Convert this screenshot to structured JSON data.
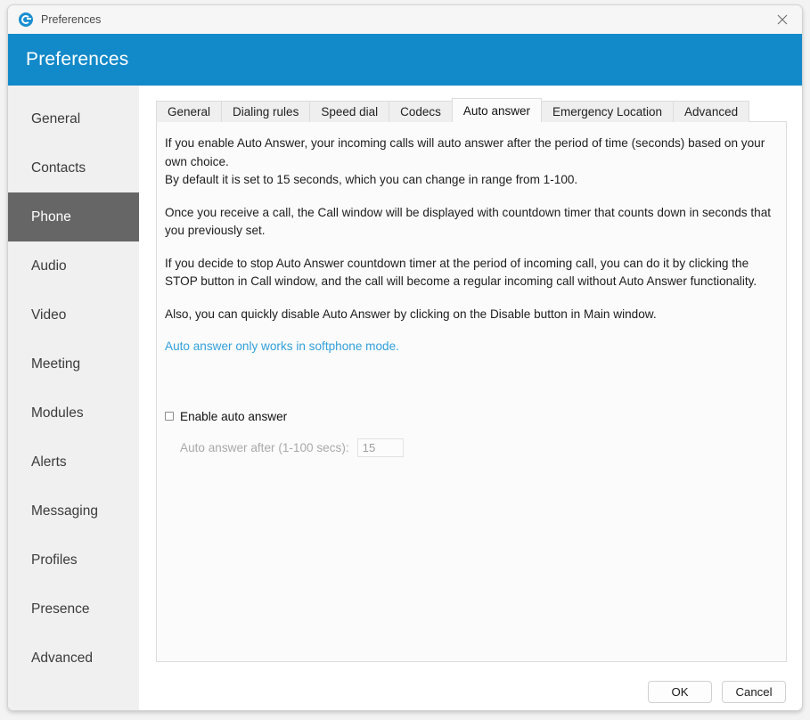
{
  "titlebar": {
    "app_icon": "app-logo-icon",
    "title": "Preferences",
    "close_icon": "close-icon"
  },
  "header": {
    "title": "Preferences",
    "accent_color": "#1289c9"
  },
  "sidebar": {
    "selected": "Phone",
    "selected_bg": "#666666",
    "items": [
      {
        "label": "General"
      },
      {
        "label": "Contacts"
      },
      {
        "label": "Phone"
      },
      {
        "label": "Audio"
      },
      {
        "label": "Video"
      },
      {
        "label": "Meeting"
      },
      {
        "label": "Modules"
      },
      {
        "label": "Alerts"
      },
      {
        "label": "Messaging"
      },
      {
        "label": "Profiles"
      },
      {
        "label": "Presence"
      },
      {
        "label": "Advanced"
      }
    ]
  },
  "main": {
    "active_tab": "Auto answer",
    "tabs": [
      {
        "label": "General"
      },
      {
        "label": "Dialing rules"
      },
      {
        "label": "Speed dial"
      },
      {
        "label": "Codecs"
      },
      {
        "label": "Auto answer"
      },
      {
        "label": "Emergency Location"
      },
      {
        "label": "Advanced"
      }
    ],
    "paragraphs": [
      "If you enable Auto Answer, your incoming calls will auto answer after the period of time (seconds) based on your own choice.\nBy default it is set to 15 seconds, which you can change in range from 1-100.",
      "Once you receive a call, the Call window will be displayed with countdown timer that counts down in seconds that you previously set.",
      "If you decide to stop Auto Answer countdown timer at the period of incoming call, you can do it by clicking the STOP button in Call window, and the call will become a regular incoming call without Auto Answer functionality.",
      "Also, you can quickly disable Auto Answer by clicking on the Disable button in Main window."
    ],
    "link_note": "Auto answer only works in softphone mode.",
    "link_color": "#31a0db",
    "enable_checkbox": {
      "label": "Enable auto answer",
      "checked": false
    },
    "auto_answer_after": {
      "label": "Auto answer after (1-100 secs):",
      "value": "15",
      "placeholder": "15",
      "disabled": true
    }
  },
  "footer": {
    "ok_label": "OK",
    "cancel_label": "Cancel"
  }
}
